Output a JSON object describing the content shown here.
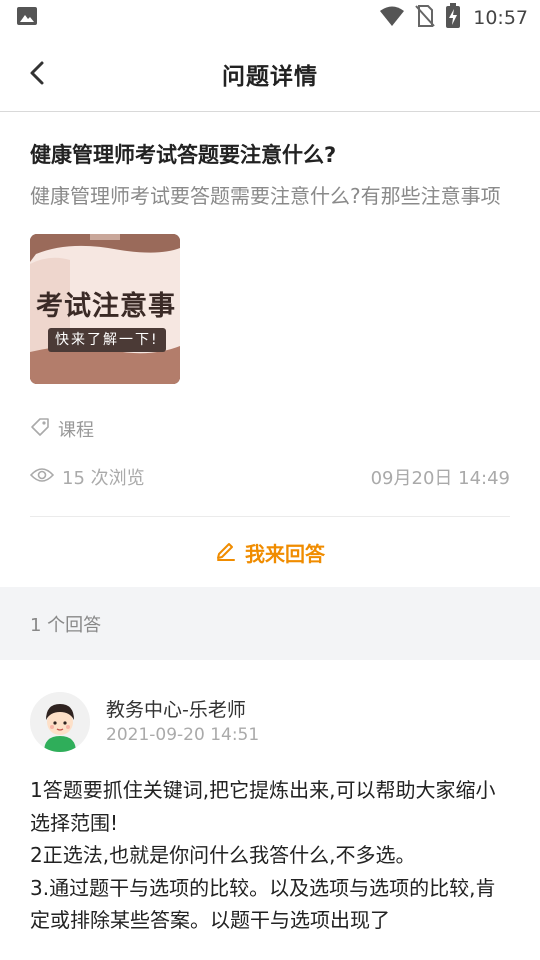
{
  "status_bar": {
    "time": "10:57",
    "icons": [
      "image-icon",
      "wifi-icon",
      "no-sim-icon",
      "battery-charging-icon"
    ]
  },
  "header": {
    "title": "问题详情",
    "back_icon": "chevron-left-icon"
  },
  "question": {
    "title": "健康管理师考试答题要注意什么?",
    "description": "健康管理师考试要答题需要注意什么?有那些注意事项",
    "image": {
      "headline": "考试注意事",
      "subline": "快来了解一下!"
    },
    "tag": "课程",
    "views": "15 次浏览",
    "time": "09月20日 14:49"
  },
  "answer_button": {
    "label": "我来回答",
    "icon": "pencil-icon"
  },
  "answers": {
    "count_label": "1 个回答",
    "items": [
      {
        "author": "教务中心-乐老师",
        "time": "2021-09-20 14:51",
        "content": [
          "1答题要抓住关键词,把它提炼出来,可以帮助大家缩小选择范围!",
          "2正选法,也就是你问什么我答什么,不多选。",
          "3.通过题干与选项的比较。以及选项与选项的比较,肯定或排除某些答案。以题干与选项出现了"
        ]
      }
    ]
  },
  "colors": {
    "accent": "#f08c00",
    "section_bg": "#f3f4f6"
  }
}
